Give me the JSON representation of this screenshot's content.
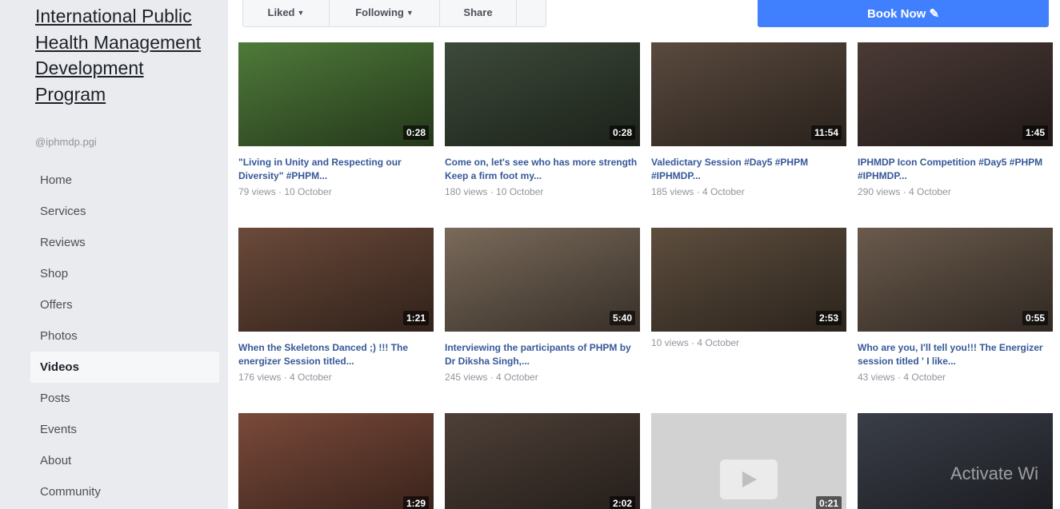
{
  "page": {
    "name": "International Public Health Management Development Program",
    "handle": "@iphmdp.pgi"
  },
  "nav": {
    "items": [
      {
        "label": "Home"
      },
      {
        "label": "Services"
      },
      {
        "label": "Reviews"
      },
      {
        "label": "Shop"
      },
      {
        "label": "Offers"
      },
      {
        "label": "Photos"
      },
      {
        "label": "Videos",
        "active": true
      },
      {
        "label": "Posts"
      },
      {
        "label": "Events"
      },
      {
        "label": "About"
      },
      {
        "label": "Community"
      }
    ]
  },
  "actions": {
    "liked": "Liked",
    "following": "Following",
    "share": "Share",
    "more": "",
    "book_now": "Book Now"
  },
  "videos": [
    {
      "duration": "0:28",
      "title": "\"Living in Unity and Respecting our Diversity\" #PHPM...",
      "meta": "79 views · 10 October",
      "thumb": "#4f7a3a"
    },
    {
      "duration": "0:28",
      "title": "Come on, let's see who has more strength Keep a firm foot my...",
      "meta": "180 views · 10 October",
      "thumb": "#3d4a3a"
    },
    {
      "duration": "11:54",
      "title": "Valedictary Session #Day5 #PHPM #IPHMDP...",
      "meta": "185 views · 4 October",
      "thumb": "#5a4a3e"
    },
    {
      "duration": "1:45",
      "title": "IPHMDP Icon Competition #Day5 #PHPM #IPHMDP...",
      "meta": "290 views · 4 October",
      "thumb": "#4a3a36"
    },
    {
      "duration": "1:21",
      "title": "When the Skeletons Danced ;) !!! The energizer Session titled...",
      "meta": "176 views · 4 October",
      "thumb": "#6b4a3a"
    },
    {
      "duration": "5:40",
      "title": "Interviewing the participants of PHPM by Dr Diksha Singh,...",
      "meta": "245 views · 4 October",
      "thumb": "#7a6a5a"
    },
    {
      "duration": "2:53",
      "title": "",
      "meta": "10 views · 4 October",
      "thumb": "#5e4e3e"
    },
    {
      "duration": "0:55",
      "title": "Who are you, I'll tell you!!! The Energizer session titled ' I like...",
      "meta": "43 views · 4 October",
      "thumb": "#6a5a4c"
    },
    {
      "duration": "1:29",
      "title": "",
      "meta": "",
      "thumb": "#7a4a3a"
    },
    {
      "duration": "2:02",
      "title": "",
      "meta": "",
      "thumb": "#4e4038"
    },
    {
      "duration": "0:21",
      "title": "",
      "meta": "",
      "thumb": "#d2d2d2",
      "placeholder": true
    },
    {
      "duration": "",
      "title": "",
      "meta": "",
      "thumb": "#3a3e48"
    }
  ],
  "watermark": "Activate Wi"
}
